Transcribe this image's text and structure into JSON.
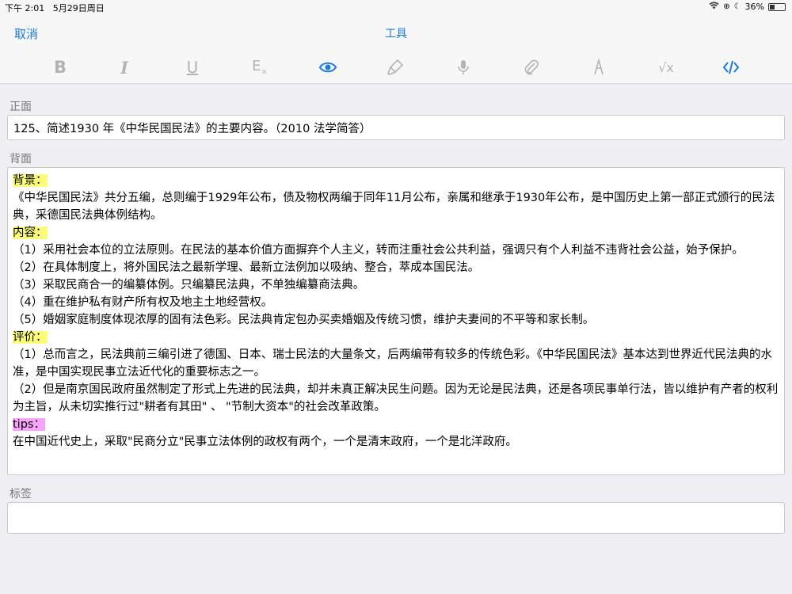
{
  "status": {
    "time": "下午 2:01",
    "date": "5月29日周日",
    "battery": "36%"
  },
  "nav": {
    "cancel": "取消",
    "title": "工具"
  },
  "toolbar": {
    "items": [
      {
        "icon": "bold-icon",
        "label": "B"
      },
      {
        "icon": "italic-icon",
        "label": "I"
      },
      {
        "icon": "underline-icon",
        "label": "U"
      },
      {
        "icon": "clear-format-icon",
        "label": "E"
      },
      {
        "icon": "eye-icon"
      },
      {
        "icon": "brush-icon"
      },
      {
        "icon": "microphone-icon"
      },
      {
        "icon": "paperclip-icon"
      },
      {
        "icon": "draw-icon"
      },
      {
        "icon": "math-icon",
        "label": "√x"
      },
      {
        "icon": "code-icon"
      }
    ],
    "active_color": "#1a7ae0",
    "inactive_color": "#b3b3b3"
  },
  "front": {
    "label": "正面",
    "text": "125、简述1930 年《中华民国民法》的主要内容。（2010 法学简答）"
  },
  "back": {
    "label": "背面",
    "lines": {
      "h1": "背景：",
      "l1": "《中华民国民法》共分五编，总则编于1929年公布，债及物权两编于同年11月公布，亲属和继承于1930年公布，是中国历史上第一部正式颁行的民法典，采德国民法典体例结构。",
      "h2": "内容：",
      "l2": "（1）采用社会本位的立法原则。在民法的基本价值方面摒弃个人主义，转而注重社会公共利益，强调只有个人利益不违背社会公益，始予保护。",
      "l3": "（2）在具体制度上，将外国民法之最新学理、最新立法例加以吸纳、整合，萃成本国民法。",
      "l4": "（3）采取民商合一的编纂体例。只编纂民法典，不单独编纂商法典。",
      "l5": "（4）重在维护私有财产所有权及地主土地经营权。",
      "l6": "（5）婚姻家庭制度体现浓厚的固有法色彩。民法典肯定包办买卖婚姻及传统习惯，维护夫妻间的不平等和家长制。",
      "h3": "评价：",
      "l7": "（1）总而言之，民法典前三编引进了德国、日本、瑞士民法的大量条文，后两编带有较多的传统色彩。《中华民国民法》基本达到世界近代民法典的水准，是中国实现民事立法近代化的重要标志之一。",
      "l8": "（2）但是南京国民政府虽然制定了形式上先进的民法典，却并未真正解决民生问题。因为无论是民法典，还是各项民事单行法，皆以维护有产者的权利为主旨，从未切实推行过\"耕者有其田\" 、 \"节制大资本\"的社会改革政策。",
      "h4": "tips：",
      "l9": "在中国近代史上，采取\"民商分立\"民事立法体例的政权有两个，一个是清末政府，一个是北洋政府。"
    }
  },
  "tags": {
    "label": "标签",
    "value": ""
  }
}
